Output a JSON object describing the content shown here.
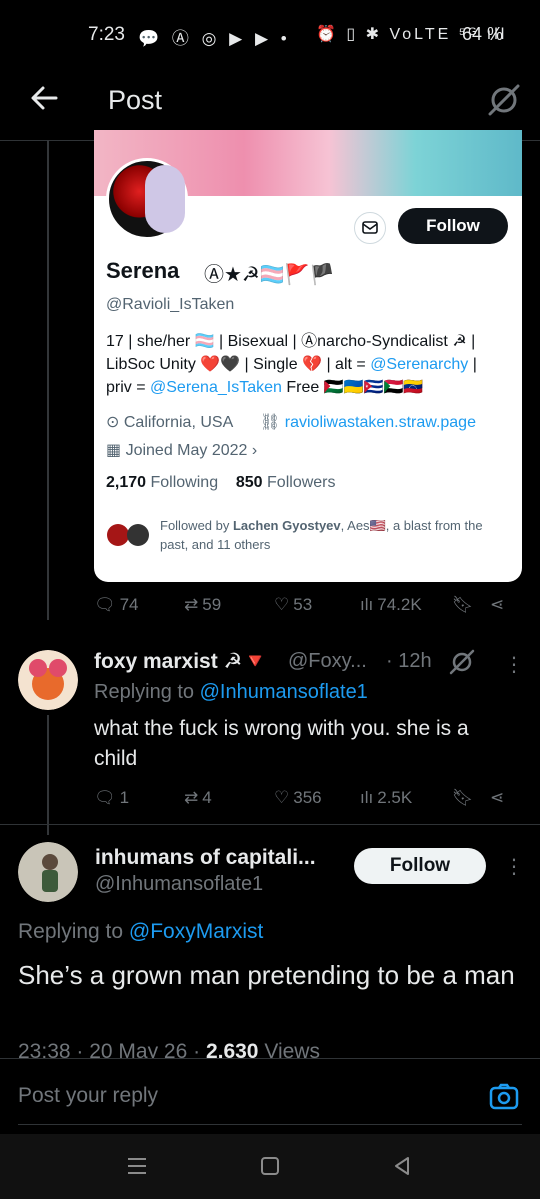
{
  "status": {
    "time": "7:23",
    "left_icons": "💬 Ⓐ ◎ ▶ ▶ •",
    "right_icons": "⏰ ▯ ✱ VoLTE ⁵ᴳ ıll",
    "battery": "64 %"
  },
  "header": {
    "title": "Post"
  },
  "card": {
    "follow_label": "Follow",
    "name": "Serena",
    "name_emoji": "Ⓐ★☭🏳️‍⚧️🚩🏴",
    "handle": "@Ravioli_IsTaken",
    "bio_part1": "17 | she/her 🏳️‍⚧️ | Bisexual | Ⓐnarcho-Syndicalist ☭ | LibSoc Unity ❤️🖤 | Single 💔 | alt = ",
    "bio_link1": "@Serenarchy",
    "bio_part2": " | priv = ",
    "bio_link2": "@Serena_IsTaken",
    "bio_part3": " Free 🇵🇸🇺🇦🇨🇺🇸🇩🇻🇪",
    "location": "California, USA",
    "url": "ravioliwastaken.straw.page",
    "joined": "Joined May 2022",
    "following_count": "2,170",
    "following_label": "Following",
    "followers_count": "850",
    "followers_label": "Followers",
    "followed_by_prefix": "Followed by ",
    "followed_by_name": "Lachen Gyostyev",
    "followed_by_rest": ", Aes🇺🇸, a blast from the past, and 11 others"
  },
  "post1_actions": {
    "replies": "74",
    "reposts": "59",
    "likes": "53",
    "views": "74.2K"
  },
  "reply": {
    "name": "foxy marxist ☭🔻",
    "handle": "@Foxy...",
    "time": "· 12h",
    "replying_to_label": "Replying to ",
    "replying_to_handle": "@Inhumansoflate1",
    "text": "what the fuck is wrong with you. she is a child",
    "replies": "1",
    "reposts": "4",
    "likes": "356",
    "views": "2.5K"
  },
  "main": {
    "name": "inhumans of capitali...",
    "handle": "@Inhumansoflate1",
    "follow_label": "Follow",
    "replying_to_label": "Replying to ",
    "replying_to_handle": "@FoxyMarxist",
    "text": "She’s a grown man pretending to be a man",
    "meta_time": "23:38 · 20 May 26 · ",
    "views_count": "2,630",
    "views_label": " Views"
  },
  "reply_bar": {
    "placeholder": "Post your reply"
  },
  "colors": {
    "accent": "#1d9bf0",
    "background": "#000000",
    "muted": "#71767b"
  }
}
